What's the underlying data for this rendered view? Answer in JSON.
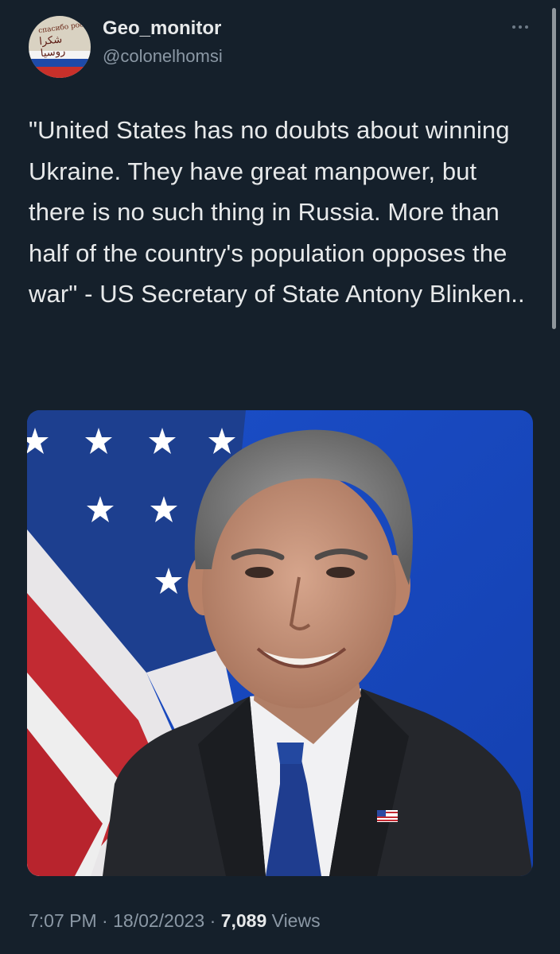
{
  "author": {
    "display_name": "Geo_monitor",
    "handle": "@colonelhomsi",
    "avatar_text_top": "спасибо росс",
    "avatar_text_arabic": "شكرا روسيا"
  },
  "tweet": {
    "text": "\"United States has no doubts about winning Ukraine. They have great manpower, but there is no such thing in Russia. More than half of the country's population opposes the war\" - US Secretary of State Antony Blinken.."
  },
  "meta": {
    "time": "7:07 PM",
    "separator": " · ",
    "date": "18/02/2023",
    "views_count": "7,089",
    "views_label": "Views"
  },
  "icons": {
    "more": "more-horizontal-icon"
  },
  "colors": {
    "background": "#15202b",
    "text": "#e7e9ea",
    "secondary": "#8b98a5"
  }
}
